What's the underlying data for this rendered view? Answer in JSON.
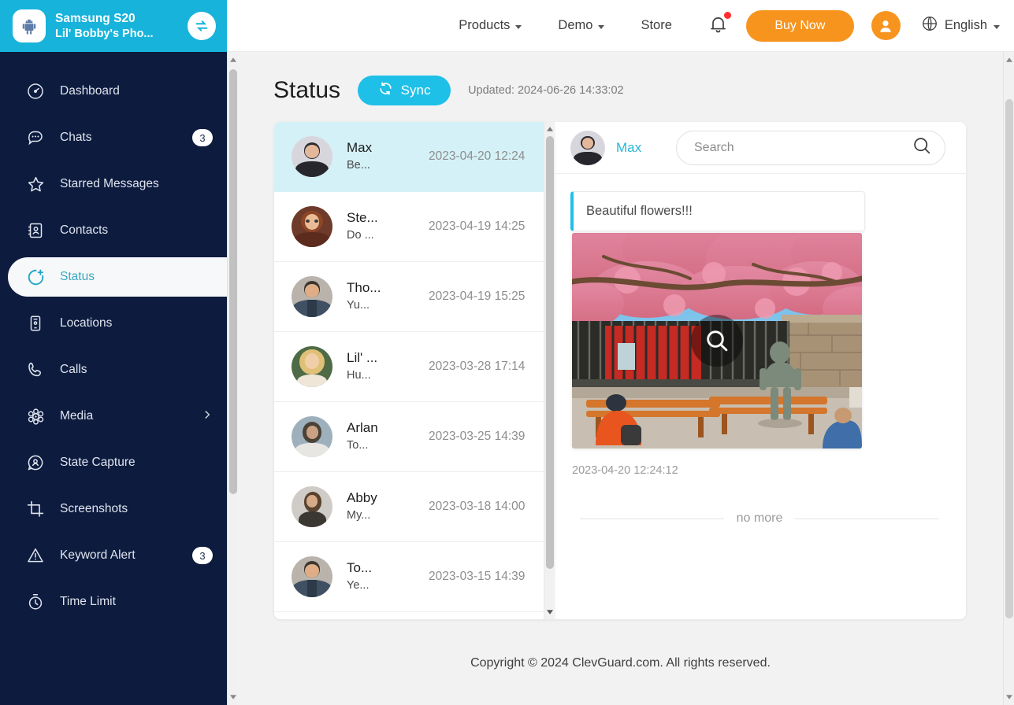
{
  "device": {
    "icon": "android-icon",
    "name": "Samsung S20",
    "subtitle": "Lil' Bobby's Pho...",
    "switch_icon": "switch-device-icon"
  },
  "topnav": {
    "links": [
      {
        "label": "Products",
        "has_caret": true
      },
      {
        "label": "Demo",
        "has_caret": true
      },
      {
        "label": "Store",
        "has_caret": false
      }
    ],
    "bell_icon": "notification-bell-icon",
    "has_notification_dot": true,
    "buy_label": "Buy Now",
    "avatar_icon": "user-avatar-icon",
    "globe_icon": "globe-icon",
    "language": "English"
  },
  "sidebar": {
    "items": [
      {
        "label": "Dashboard",
        "icon": "dashboard-icon",
        "badge": "",
        "chevron": false,
        "active": false
      },
      {
        "label": "Chats",
        "icon": "chat-bubble-icon",
        "badge": "3",
        "chevron": false,
        "active": false
      },
      {
        "label": "Starred Messages",
        "icon": "star-icon",
        "badge": "",
        "chevron": false,
        "active": false
      },
      {
        "label": "Contacts",
        "icon": "contacts-icon",
        "badge": "",
        "chevron": false,
        "active": false
      },
      {
        "label": "Status",
        "icon": "status-icon",
        "badge": "",
        "chevron": false,
        "active": true
      },
      {
        "label": "Locations",
        "icon": "location-phone-icon",
        "badge": "",
        "chevron": false,
        "active": false
      },
      {
        "label": "Calls",
        "icon": "phone-icon",
        "badge": "",
        "chevron": false,
        "active": false
      },
      {
        "label": "Media",
        "icon": "media-flower-icon",
        "badge": "",
        "chevron": true,
        "active": false
      },
      {
        "label": "State Capture",
        "icon": "state-capture-icon",
        "badge": "",
        "chevron": false,
        "active": false
      },
      {
        "label": "Screenshots",
        "icon": "crop-icon",
        "badge": "",
        "chevron": false,
        "active": false
      },
      {
        "label": "Keyword Alert",
        "icon": "warning-icon",
        "badge": "3",
        "chevron": false,
        "active": false
      },
      {
        "label": "Time Limit",
        "icon": "timer-icon",
        "badge": "",
        "chevron": false,
        "active": false
      }
    ]
  },
  "page": {
    "title": "Status",
    "sync_label": "Sync",
    "sync_icon": "refresh-icon",
    "updated": "Updated: 2024-06-26 14:33:02"
  },
  "status_list": {
    "rows": [
      {
        "name": "Max",
        "preview": "Be...",
        "time": "2023-04-20 12:24",
        "selected": true
      },
      {
        "name": "Ste...",
        "preview": "Do ...",
        "time": "2023-04-19 14:25",
        "selected": false
      },
      {
        "name": "Tho...",
        "preview": "Yu...",
        "time": "2023-04-19 15:25",
        "selected": false
      },
      {
        "name": "Lil' ...",
        "preview": "Hu...",
        "time": "2023-03-28 17:14",
        "selected": false
      },
      {
        "name": "Arlan",
        "preview": "To...",
        "time": "2023-03-25 14:39",
        "selected": false
      },
      {
        "name": "Abby",
        "preview": "My...",
        "time": "2023-03-18 14:00",
        "selected": false
      },
      {
        "name": "To...",
        "preview": "Ye...",
        "time": "2023-03-15 14:39",
        "selected": false
      }
    ]
  },
  "detail": {
    "contact_name": "Max",
    "search_placeholder": "Search",
    "search_value": "",
    "search_icon": "search-icon",
    "post": {
      "text": "Beautiful flowers!!!",
      "media_icon": "magnify-icon",
      "media_alt": "cherry-blossom-park-photo",
      "timestamp": "2023-04-20 12:24:12"
    },
    "end_label": "no more"
  },
  "footer": {
    "copyright": "Copyright © 2024 ClevGuard.com. All rights reserved."
  },
  "colors": {
    "sidebar_bg": "#0d1b3e",
    "device_header": "#17b3da",
    "accent_cyan": "#1ec0e8",
    "accent_orange": "#f7941e",
    "selected_row": "#d4f1f7",
    "page_bg": "#f2f2f2"
  }
}
